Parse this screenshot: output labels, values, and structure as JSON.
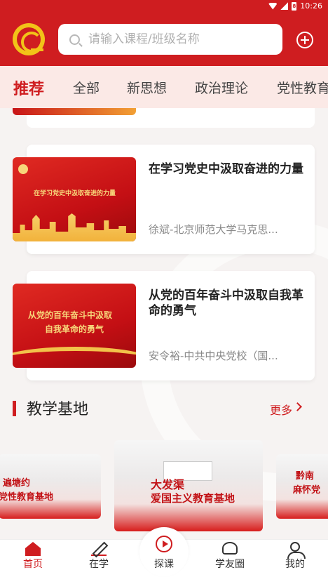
{
  "status_bar": {
    "time": "10:26",
    "battery": "8"
  },
  "search": {
    "placeholder": "请输入课程/班级名称"
  },
  "tabs": [
    {
      "label": "推荐"
    },
    {
      "label": "全部"
    },
    {
      "label": "新思想"
    },
    {
      "label": "政治理论"
    },
    {
      "label": "党性教育"
    }
  ],
  "courses": [
    {
      "title": "在学习党史中汲取奋进的力量",
      "subtitle": "徐斌-北京师范大学马克思...",
      "thumb_text": "在学习党史中汲取奋进的力量"
    },
    {
      "title": "从党的百年奋斗中汲取自我革命的勇气",
      "subtitle": "安令裕-中共中央党校（国...",
      "thumb_text_1": "从党的百年奋斗中汲取",
      "thumb_text_2": "自我革命的勇气"
    }
  ],
  "section": {
    "title": "教学基地",
    "more": "更多"
  },
  "bases": [
    {
      "text_1": "遍塘约",
      "text_2": "党性教育基地"
    },
    {
      "text_1": "大发渠",
      "text_2": "爱国主义教育基地"
    },
    {
      "text_1": "黔南",
      "text_2": "麻怀党"
    }
  ],
  "bottom_nav": [
    {
      "label": "首页"
    },
    {
      "label": "在学"
    },
    {
      "label": "探课"
    },
    {
      "label": "学友圈"
    },
    {
      "label": "我的"
    }
  ],
  "colors": {
    "brand_red": "#cf1d20",
    "gold": "#f2c318"
  }
}
